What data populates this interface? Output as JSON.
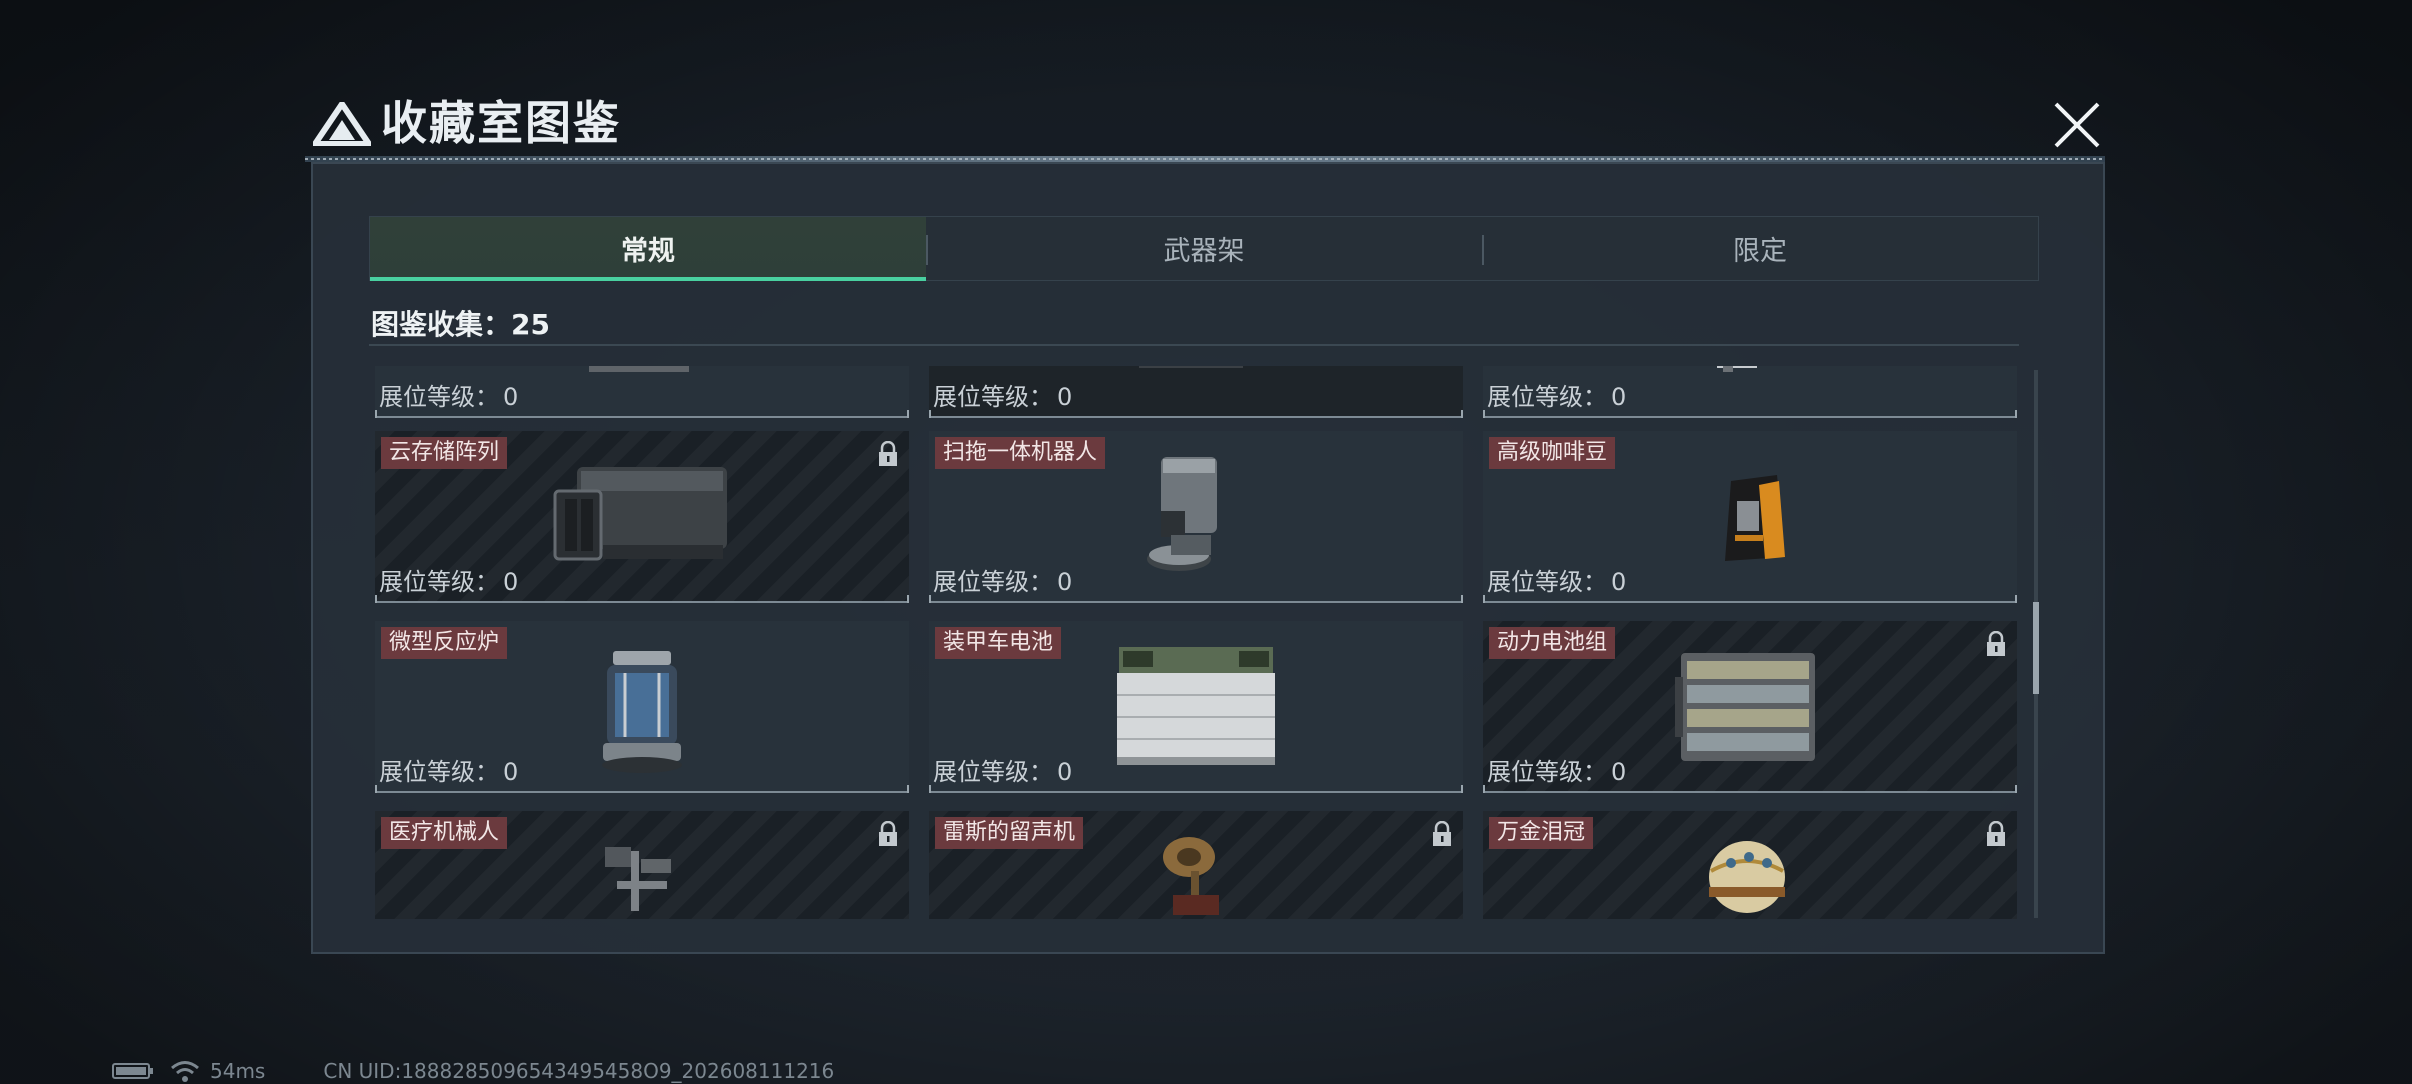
{
  "window": {
    "title": "收藏室图鉴",
    "close_icon": "close-icon"
  },
  "tabs": [
    {
      "label": "常规",
      "active": true
    },
    {
      "label": "武器架",
      "active": false
    },
    {
      "label": "限定",
      "active": false
    }
  ],
  "collection": {
    "label": "图鉴收集：25"
  },
  "level_label": "展位等级：",
  "cards": [
    {
      "name": "",
      "level": "0",
      "locked": false,
      "icon": "partial-item-icon"
    },
    {
      "name": "",
      "level": "0",
      "locked": false,
      "icon": "partial-item-icon"
    },
    {
      "name": "",
      "level": "0",
      "locked": false,
      "icon": "partial-item-icon"
    },
    {
      "name": "云存储阵列",
      "level": "0",
      "locked": true,
      "icon": "storage-array-icon"
    },
    {
      "name": "扫拖一体机器人",
      "level": "0",
      "locked": false,
      "icon": "mop-robot-icon"
    },
    {
      "name": "高级咖啡豆",
      "level": "0",
      "locked": false,
      "icon": "coffee-bag-icon"
    },
    {
      "name": "微型反应炉",
      "level": "0",
      "locked": false,
      "icon": "reactor-icon"
    },
    {
      "name": "装甲车电池",
      "level": "0",
      "locked": false,
      "icon": "car-battery-icon"
    },
    {
      "name": "动力电池组",
      "level": "0",
      "locked": true,
      "icon": "battery-pack-icon"
    },
    {
      "name": "医疗机械人",
      "level": "",
      "locked": true,
      "icon": "medical-robot-icon"
    },
    {
      "name": "雷斯的留声机",
      "level": "",
      "locked": true,
      "icon": "gramophone-icon"
    },
    {
      "name": "万金泪冠",
      "level": "",
      "locked": true,
      "icon": "jeweled-egg-icon"
    }
  ],
  "status_bar": {
    "ping": "54ms",
    "uid": "CN UID:1888285096543495458O9_202608111216",
    "battery_icon": "battery-icon",
    "wifi_icon": "wifi-icon"
  },
  "colors": {
    "accent_green": "#49d0a0",
    "name_tag": "#6b3a3e",
    "panel": "#262f38"
  }
}
